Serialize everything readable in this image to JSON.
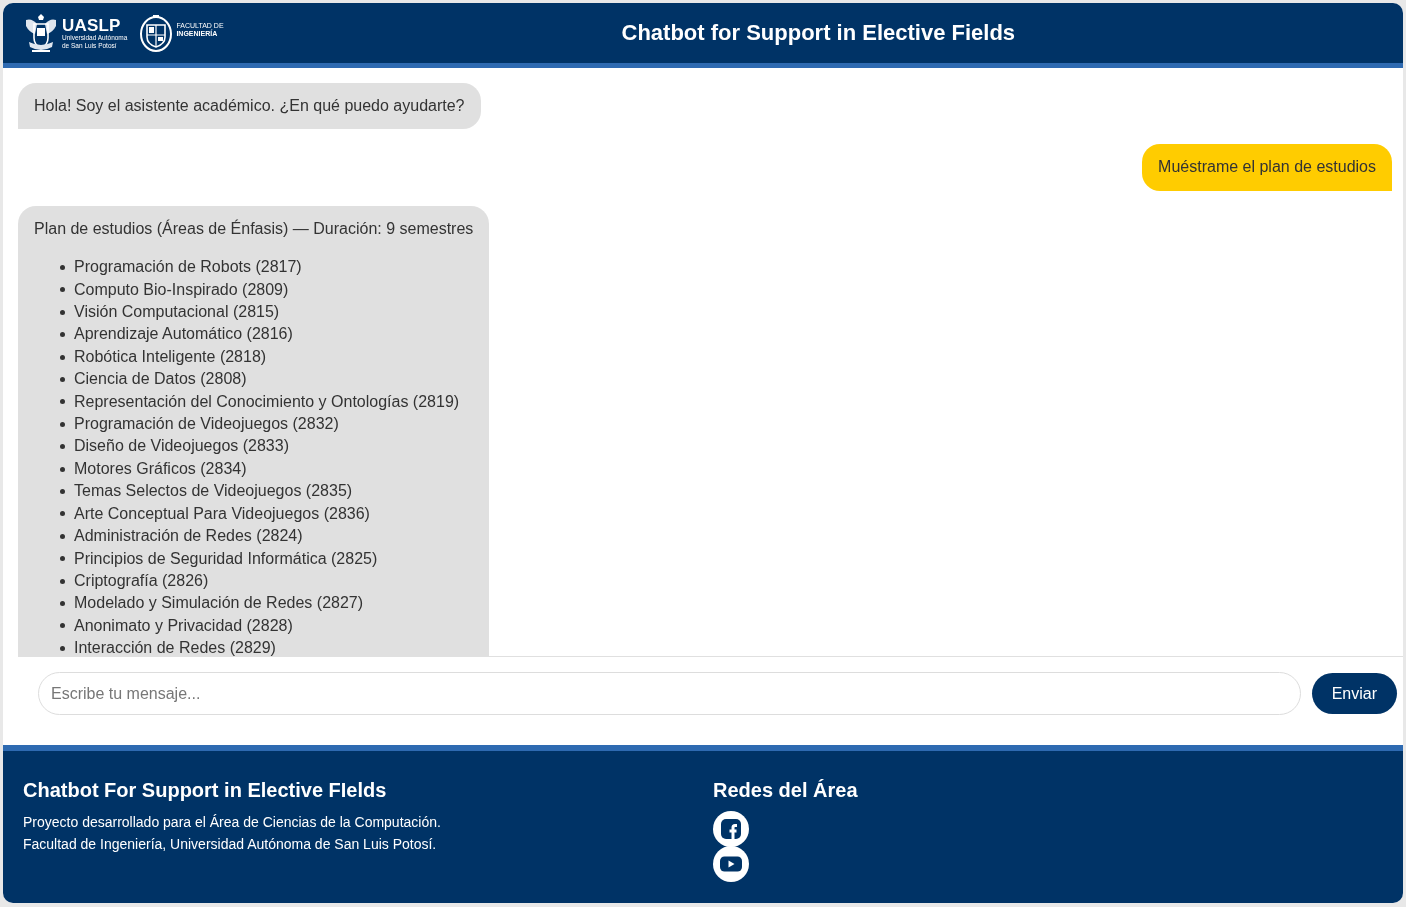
{
  "header": {
    "university_logo": {
      "name": "UASLP",
      "lines": [
        "Universidad Autónoma",
        "de San Luis Potosí"
      ]
    },
    "faculty_logo": {
      "lines": [
        "FACULTAD DE",
        "INGENIERÍA"
      ]
    },
    "title": "Chatbot for Support in Elective Fields"
  },
  "messages": [
    {
      "kind": "bot",
      "text": "Hola! Soy el asistente académico. ¿En qué puedo ayudarte?"
    },
    {
      "kind": "user",
      "text": "Muéstrame el plan de estudios"
    },
    {
      "kind": "bot",
      "text": "Plan de estudios (Áreas de Énfasis) — Duración: 9 semestres",
      "items": [
        "Programación de Robots (2817)",
        "Computo Bio-Inspirado (2809)",
        "Visión Computacional (2815)",
        "Aprendizaje Automático (2816)",
        "Robótica Inteligente (2818)",
        "Ciencia de Datos (2808)",
        "Representación del Conocimiento y Ontologías (2819)",
        "Programación de Videojuegos (2832)",
        "Diseño de Videojuegos (2833)",
        "Motores Gráficos (2834)",
        "Temas Selectos de Videojuegos (2835)",
        "Arte Conceptual Para Videojuegos (2836)",
        "Administración de Redes (2824)",
        "Principios de Seguridad Informática (2825)",
        "Criptografía (2826)",
        "Modelado y Simulación de Redes (2827)",
        "Anonimato y Privacidad (2828)",
        "Interacción de Redes (2829)"
      ]
    }
  ],
  "composer": {
    "placeholder": "Escribe tu mensaje...",
    "button": "Enviar"
  },
  "footer": {
    "title": "Chatbot For Support in Elective FIelds",
    "lines": [
      "Proyecto desarrollado para el Área de Ciencias de la Computación.",
      "Facultad de Ingeniería, Universidad Autónoma de San Luis Potosí."
    ],
    "social": {
      "title": "Redes del Área",
      "links": [
        {
          "kind": "facebook"
        },
        {
          "kind": "youtube"
        }
      ]
    }
  }
}
